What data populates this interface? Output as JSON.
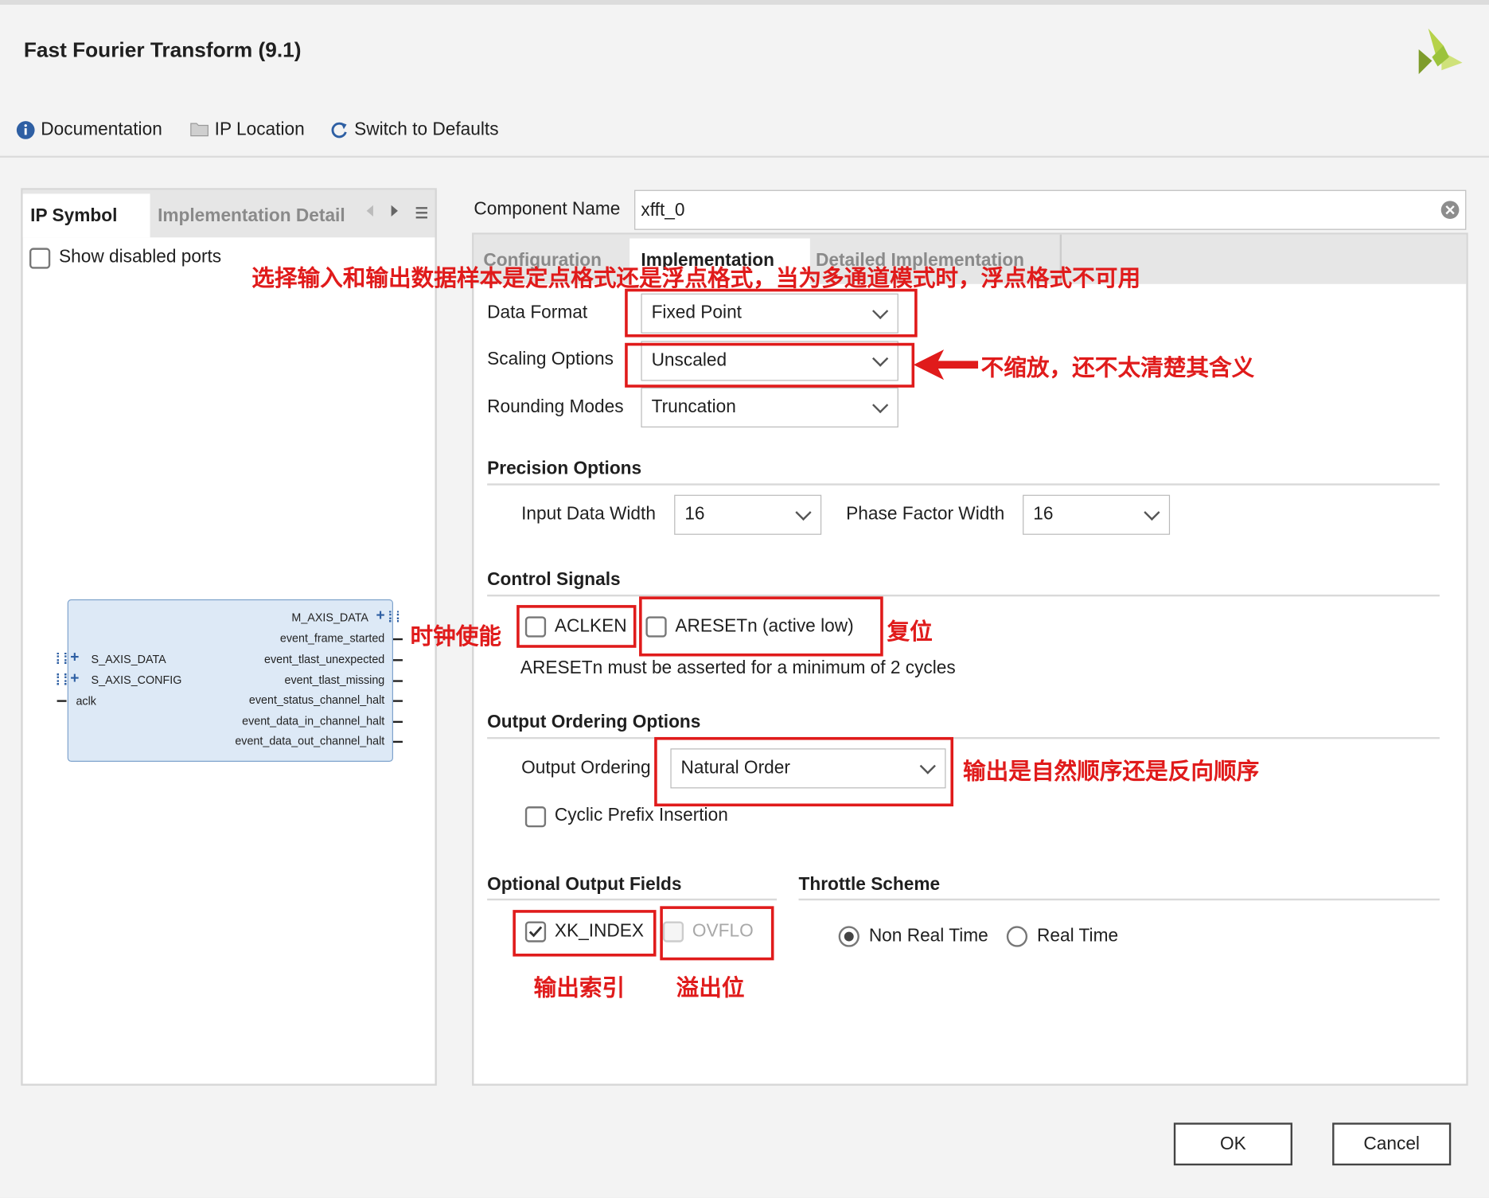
{
  "window": {
    "title": "Fast Fourier Transform (9.1)"
  },
  "toolbar": {
    "documentation": "Documentation",
    "ip_location": "IP Location",
    "switch_defaults": "Switch to Defaults"
  },
  "left_panel": {
    "tabs": [
      "IP Symbol",
      "Implementation Detail"
    ],
    "show_disabled_ports": "Show disabled ports",
    "symbol": {
      "left_ports": [
        "S_AXIS_DATA",
        "S_AXIS_CONFIG",
        "aclk"
      ],
      "right_ports": [
        "M_AXIS_DATA",
        "event_frame_started",
        "event_tlast_unexpected",
        "event_tlast_missing",
        "event_status_channel_halt",
        "event_data_in_channel_halt",
        "event_data_out_channel_halt"
      ]
    }
  },
  "component": {
    "label": "Component Name",
    "value": "xfft_0"
  },
  "tabs": [
    "Configuration",
    "Implementation",
    "Detailed Implementation"
  ],
  "form": {
    "data_format": {
      "label": "Data Format",
      "value": "Fixed Point"
    },
    "scaling_options": {
      "label": "Scaling Options",
      "value": "Unscaled"
    },
    "rounding_modes": {
      "label": "Rounding Modes",
      "value": "Truncation"
    },
    "precision": {
      "title": "Precision Options",
      "input_width_label": "Input Data Width",
      "input_width_value": "16",
      "phase_width_label": "Phase Factor Width",
      "phase_width_value": "16"
    },
    "control": {
      "title": "Control Signals",
      "aclken": "ACLKEN",
      "aresetn": "ARESETn (active low)",
      "note": "ARESETn must be asserted for a minimum of 2 cycles"
    },
    "output_ordering": {
      "title": "Output Ordering Options",
      "label": "Output Ordering",
      "value": "Natural Order",
      "cyclic_prefix": "Cyclic Prefix Insertion"
    },
    "optional_fields": {
      "title": "Optional Output Fields",
      "xk_index": "XK_INDEX",
      "ovflo": "OVFLO"
    },
    "throttle": {
      "title": "Throttle Scheme",
      "non_real_time": "Non Real Time",
      "real_time": "Real Time"
    }
  },
  "buttons": {
    "ok": "OK",
    "cancel": "Cancel"
  },
  "annotations": {
    "data_format_note": "选择输入和输出数据样本是定点格式还是浮点格式，当为多通道模式时，浮点格式不可用",
    "scaling_note": "不缩放，还不太清楚其含义",
    "clock_enable": "时钟使能",
    "reset": "复位",
    "ordering_note": "输出是自然顺序还是反向顺序",
    "output_index": "输出索引",
    "overflow_bit": "溢出位"
  },
  "colors": {
    "annotation": "#e01b1b",
    "logo": "#9bc33c"
  }
}
